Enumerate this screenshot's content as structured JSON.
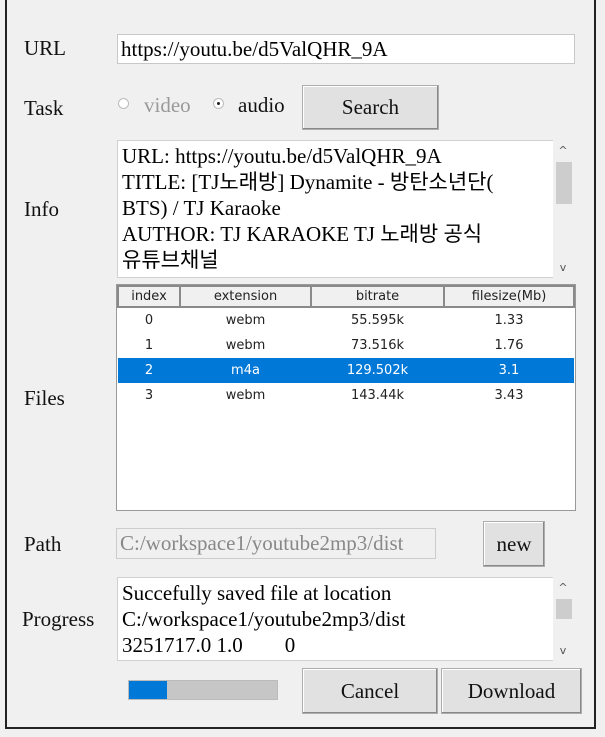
{
  "labels": {
    "url": "URL",
    "task": "Task",
    "info": "Info",
    "files": "Files",
    "path": "Path",
    "progress": "Progress"
  },
  "url_value": "https://youtu.be/d5ValQHR_9A",
  "task": {
    "options": [
      "video",
      "audio"
    ],
    "selected": "audio",
    "search_label": "Search"
  },
  "info_lines": [
    "URL: https://youtu.be/d5ValQHR_9A",
    "TITLE: [TJ노래방] Dynamite - 방탄소년단(",
    "BTS) / TJ Karaoke",
    "AUTHOR: TJ KARAOKE TJ 노래방 공식",
    "유튜브채널"
  ],
  "files": {
    "columns": [
      "index",
      "extension",
      "bitrate",
      "filesize(Mb)"
    ],
    "rows": [
      [
        "0",
        "webm",
        "55.595k",
        "1.33"
      ],
      [
        "1",
        "webm",
        "73.516k",
        "1.76"
      ],
      [
        "2",
        "m4a",
        "129.502k",
        "3.1"
      ],
      [
        "3",
        "webm",
        "143.44k",
        "3.43"
      ]
    ],
    "selected_index": 2
  },
  "path_value": "C:/workspace1/youtube2mp3/dist",
  "new_label": "new",
  "progress_lines": [
    "Succefully saved file at location",
    "C:/workspace1/youtube2mp3/dist",
    "3251717.0 1.0        0"
  ],
  "progress_fraction": 0.26,
  "cancel_label": "Cancel",
  "download_label": "Download",
  "colors": {
    "accent": "#0078d7"
  }
}
